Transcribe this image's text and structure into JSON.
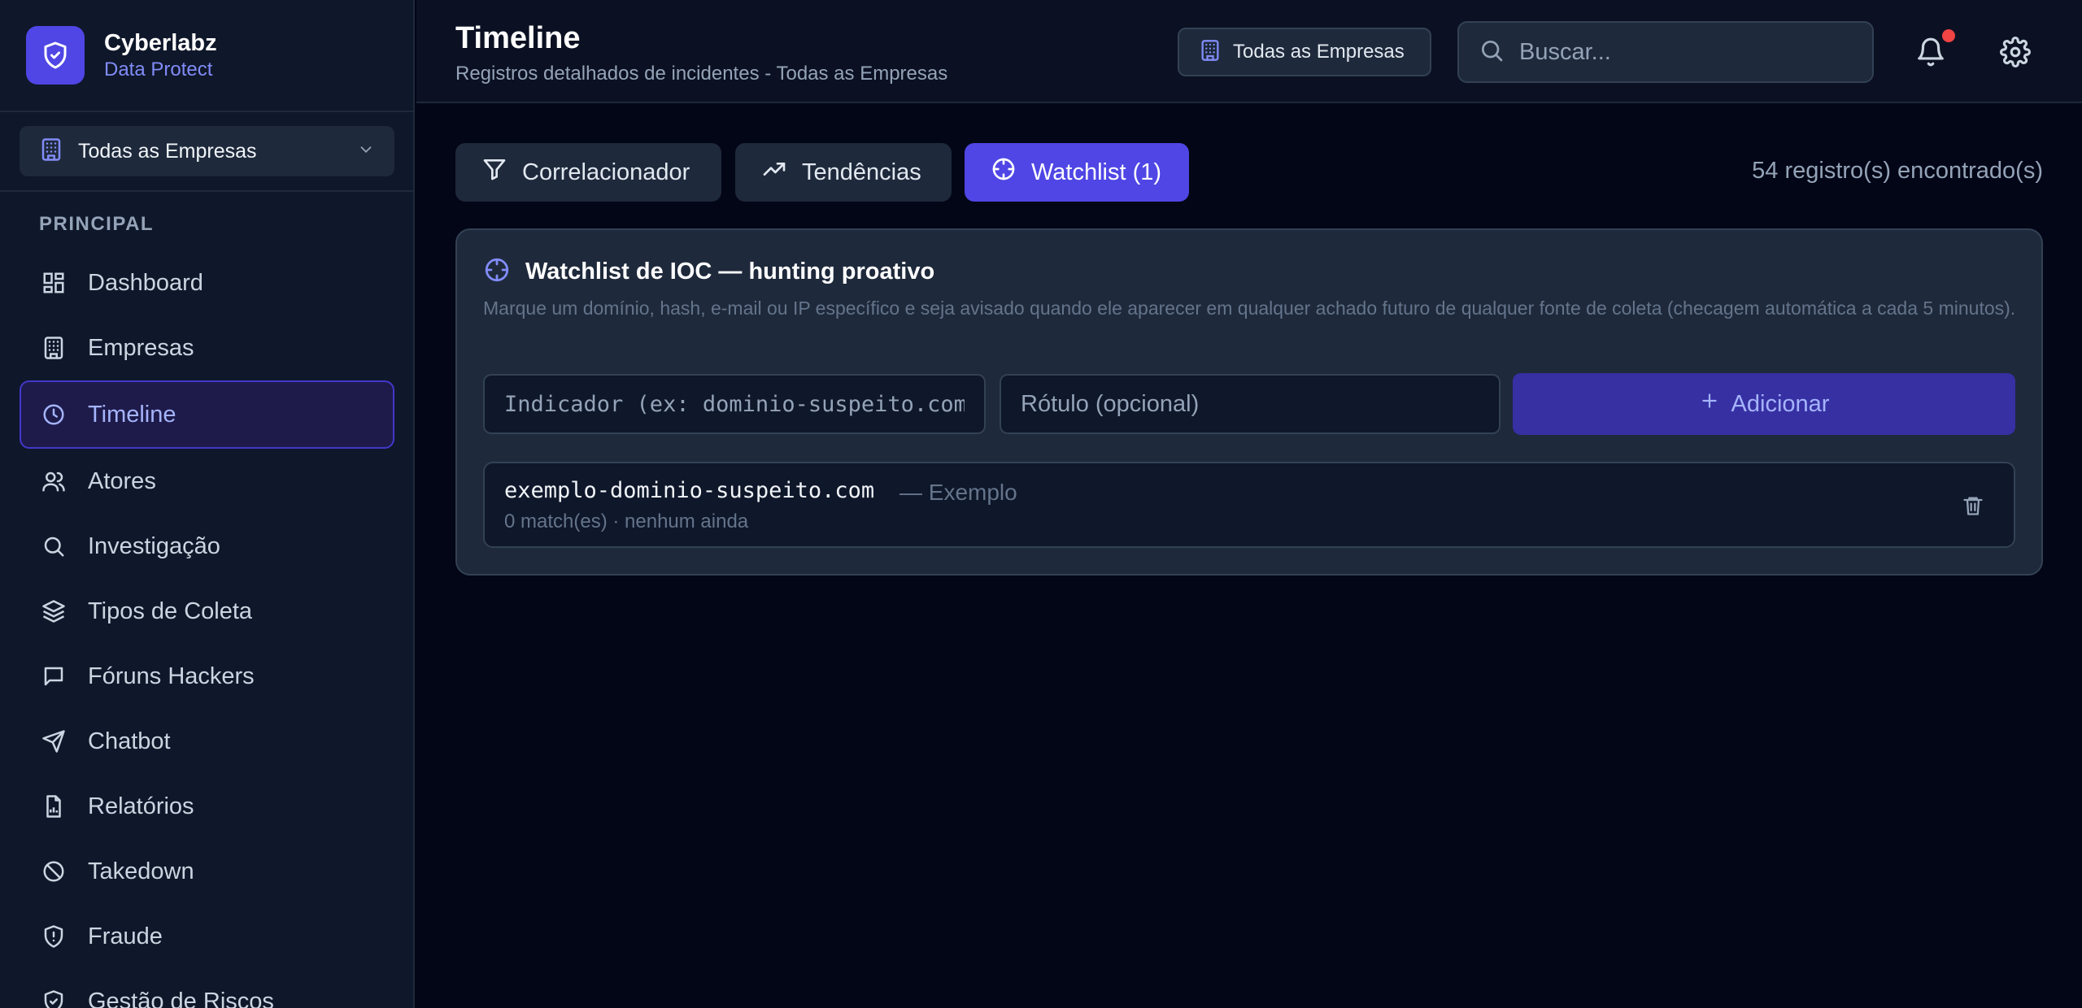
{
  "brand": {
    "name": "Cyberlabz",
    "subtitle": "Data Protect"
  },
  "sidebar": {
    "company_select": "Todas as Empresas",
    "section": "PRINCIPAL",
    "items": [
      {
        "label": "Dashboard",
        "icon": "dashboard-icon"
      },
      {
        "label": "Empresas",
        "icon": "building-icon"
      },
      {
        "label": "Timeline",
        "icon": "clock-icon",
        "active": true
      },
      {
        "label": "Atores",
        "icon": "users-icon"
      },
      {
        "label": "Investigação",
        "icon": "search-icon"
      },
      {
        "label": "Tipos de Coleta",
        "icon": "layers-icon"
      },
      {
        "label": "Fóruns Hackers",
        "icon": "message-icon"
      },
      {
        "label": "Chatbot",
        "icon": "send-icon"
      },
      {
        "label": "Relatórios",
        "icon": "report-icon"
      },
      {
        "label": "Takedown",
        "icon": "ban-icon"
      },
      {
        "label": "Fraude",
        "icon": "shield-alert-icon"
      },
      {
        "label": "Gestão de Riscos",
        "icon": "shield-check-icon"
      }
    ]
  },
  "header": {
    "title": "Timeline",
    "subtitle": "Registros detalhados de incidentes - Todas as Empresas",
    "company_chip": "Todas as Empresas",
    "search_placeholder": "Buscar..."
  },
  "tabs": [
    {
      "label": "Correlacionador",
      "icon": "filter-icon"
    },
    {
      "label": "Tendências",
      "icon": "trending-up-icon"
    },
    {
      "label": "Watchlist (1)",
      "icon": "crosshair-icon",
      "active": true
    }
  ],
  "records_count": "54 registro(s) encontrado(s)",
  "watchlist": {
    "title": "Watchlist de IOC — hunting proativo",
    "description": "Marque um domínio, hash, e-mail ou IP específico e seja avisado quando ele aparecer em qualquer achado futuro de qualquer fonte de coleta (checagem automática a cada 5 minutos).",
    "indicator_placeholder": "Indicador (ex: dominio-suspeito.com)",
    "label_placeholder": "Rótulo (opcional)",
    "add_label": "Adicionar",
    "items": [
      {
        "value": "exemplo-dominio-suspeito.com",
        "label": "— Exemplo",
        "meta": "0 match(es) · nenhum ainda"
      }
    ]
  },
  "colors": {
    "accent": "#4f46e5",
    "background": "#030616",
    "surface": "#1e293b",
    "notification": "#ef4444"
  }
}
